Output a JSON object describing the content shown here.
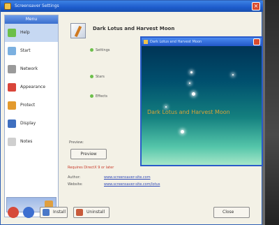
{
  "window": {
    "title": "Screensaver Settings",
    "close_glyph": "×"
  },
  "sidebar": {
    "header": "Menu",
    "items": [
      {
        "label": "Help",
        "icon": "help-icon",
        "color": "#6cbf4a",
        "selected": true
      },
      {
        "label": "Start",
        "icon": "start-icon",
        "color": "#7bb0e0"
      },
      {
        "label": "Network",
        "icon": "network-icon",
        "color": "#9a9a9a"
      },
      {
        "label": "Appearance",
        "icon": "appearance-icon",
        "color": "#d9453a"
      },
      {
        "label": "Protect",
        "icon": "protect-icon",
        "color": "#e39a2d"
      },
      {
        "label": "Display",
        "icon": "display-icon",
        "color": "#3f6fbf"
      },
      {
        "label": "Notes",
        "icon": "notes-icon",
        "color": "#cfcfcf"
      }
    ]
  },
  "main": {
    "heading": "Dark Lotus and Harvest Moon",
    "options": [
      {
        "label": "Settings"
      },
      {
        "label": "Stars"
      },
      {
        "label": "Effects"
      }
    ],
    "preview_label": "Preview:",
    "preview_button": "Preview",
    "red_notice": "Requires DirectX 9 or later",
    "info": [
      {
        "label": "Author:",
        "link": "www.screensaver-site.com"
      },
      {
        "label": "Website:",
        "link": "www.screensaver-site.com/lotus"
      }
    ]
  },
  "bottom": {
    "install_button": "Install",
    "uninstall_button": "Uninstall",
    "close_button": "Close"
  },
  "preview_window": {
    "title": "Dark Lotus and Harvest Moon",
    "overlay_text": "Dark Lotus and Harvest Moon"
  }
}
